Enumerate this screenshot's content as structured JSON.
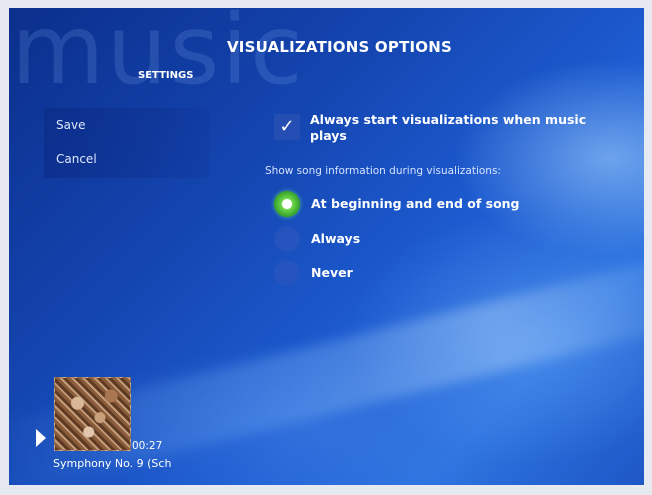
{
  "background_text": "music",
  "header": {
    "title": "VISUALIZATIONS OPTIONS",
    "section": "SETTINGS"
  },
  "side_menu": {
    "save_label": "Save",
    "cancel_label": "Cancel"
  },
  "options": {
    "autostart_checked": true,
    "autostart_label": "Always start visualizations when music plays",
    "song_info_label": "Show song information during visualizations:",
    "radios": [
      {
        "label": "At beginning and end of song",
        "selected": true
      },
      {
        "label": "Always",
        "selected": false
      },
      {
        "label": "Never",
        "selected": false
      }
    ]
  },
  "now_playing": {
    "time": "00:27",
    "title": "Symphony No. 9 (Sch"
  },
  "colors": {
    "accent_selected": "#4fc236",
    "background": "#1d5bd0"
  }
}
